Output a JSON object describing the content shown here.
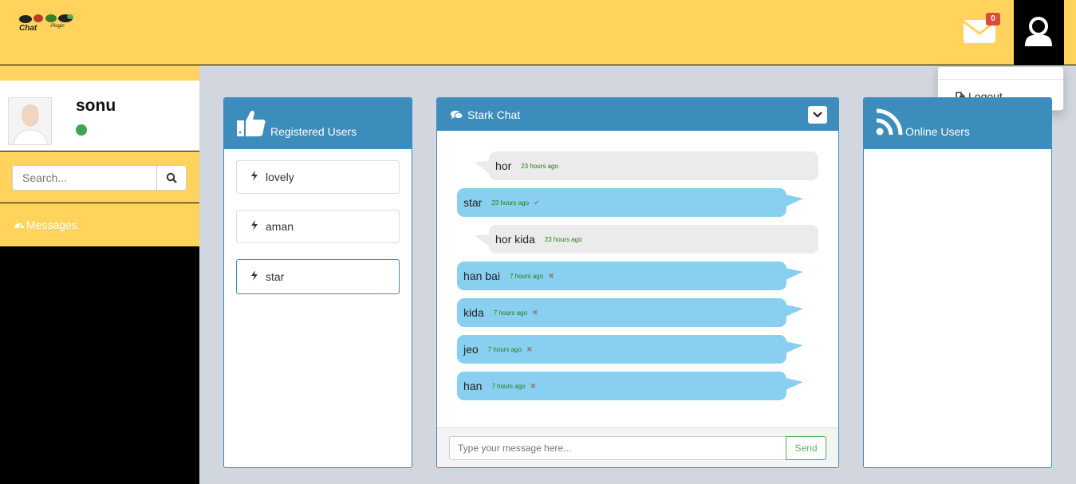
{
  "header": {
    "logo_text": "Chat-Plugin",
    "mail_badge": "0",
    "colors": {
      "header_bg": "#ffd35c",
      "accent": "#3c8dbc",
      "badge": "#dd4b39"
    }
  },
  "dropdown": {
    "logout_label": "Logout"
  },
  "sidebar": {
    "username": "sonu",
    "status": "Online",
    "search_placeholder": "Search...",
    "messages_label": "Messages"
  },
  "registered": {
    "title": "Registered Users",
    "users": [
      "lovely",
      "aman",
      "star"
    ]
  },
  "chat": {
    "title": "Stark Chat",
    "messages": [
      {
        "text": "hor",
        "time": "23 hours ago",
        "dir": "in"
      },
      {
        "text": "star",
        "time": "23 hours ago",
        "dir": "out",
        "status": "seen"
      },
      {
        "text": "hor kida",
        "time": "23 hours ago",
        "dir": "in"
      },
      {
        "text": "han bai",
        "time": "7 hours ago",
        "dir": "out",
        "status": "unseen"
      },
      {
        "text": "kida",
        "time": "7 hours ago",
        "dir": "out",
        "status": "unseen"
      },
      {
        "text": "jeo",
        "time": "7 hours ago",
        "dir": "out",
        "status": "unseen"
      },
      {
        "text": "han",
        "time": "7 hours ago",
        "dir": "out",
        "status": "unseen"
      }
    ],
    "input_placeholder": "Type your message here...",
    "send_label": "Send"
  },
  "online": {
    "title": "Online Users"
  }
}
